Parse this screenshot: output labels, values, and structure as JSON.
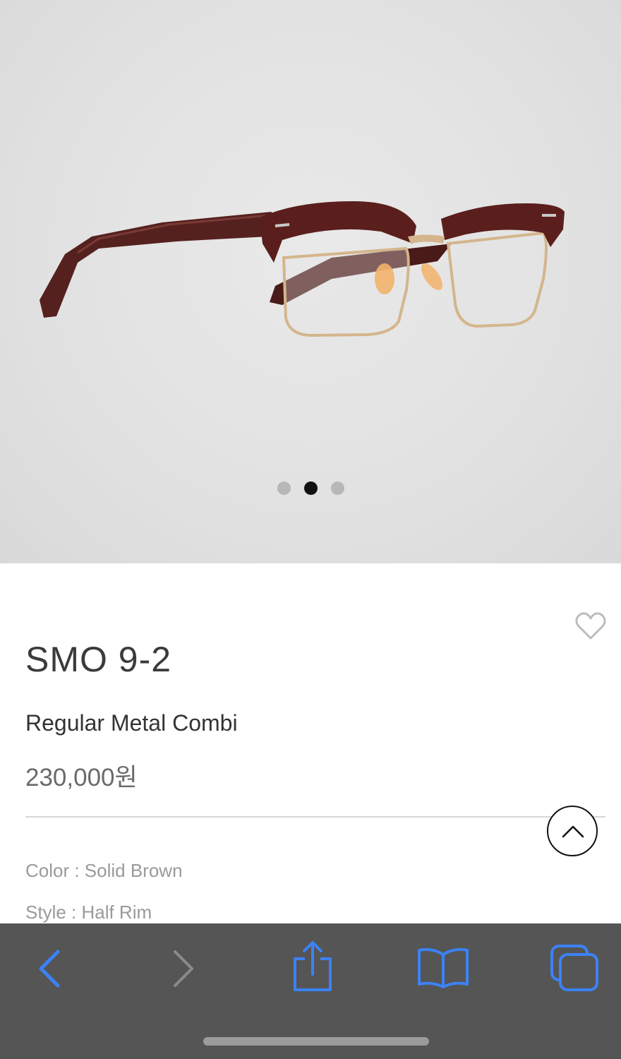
{
  "product": {
    "name": "SMO 9-2",
    "subtitle": "Regular Metal Combi",
    "price": "230,000원",
    "color_line": "Color : Solid Brown",
    "style_line": "Style : Half Rim"
  },
  "carousel": {
    "image_subject": "brown half-rim glasses",
    "slide_count": 3,
    "active_slide": 2
  },
  "icons": {
    "wishlist": "heart-icon",
    "scroll_top": "chevron-up-icon",
    "back": "chevron-left-icon",
    "forward": "chevron-right-icon",
    "share": "share-icon",
    "bookmarks": "book-icon",
    "tabs": "tabs-icon"
  },
  "colors": {
    "accent": "#3b82f6",
    "toolbar": "#555555",
    "frame_brown": "#5a1f1c"
  }
}
